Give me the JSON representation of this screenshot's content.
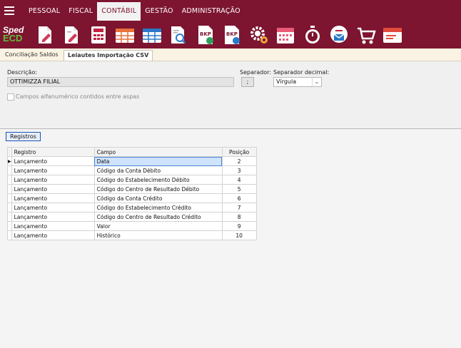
{
  "menu": [
    "PESSOAL",
    "FISCAL",
    "CONTÁBIL",
    "GESTÃO",
    "ADMINISTRAÇÃO"
  ],
  "active_menu": "CONTÁBIL",
  "logo": {
    "line1": "Sped",
    "line2": "ECD"
  },
  "toolbar_icons": [
    "document-edit-icon",
    "document-edit-icon",
    "calculator-icon",
    "table-orange-icon",
    "table-blue-icon",
    "document-search-icon",
    "bkp-backup-icon",
    "bkp-restore-icon",
    "settings-gears-icon",
    "calendar-icon",
    "stopwatch-icon",
    "mail-inbox-icon",
    "shopping-cart-icon",
    "message-card-icon"
  ],
  "toolbar_text": {
    "bkp": "BKP"
  },
  "tabs": [
    "Conciliação Saldos",
    "Leiautes Importação CSV"
  ],
  "form": {
    "descricao_label": "Descrição:",
    "descricao_value": "OTTIMIZZA FILIAL",
    "separador_label": "Separador:",
    "separador_value": ";",
    "separador_decimal_label": "Separador decimal:",
    "separador_decimal_value": "Vírgula",
    "checkbox_label": "Campos alfanumérico contidos entre aspas"
  },
  "grid": {
    "button": "Registros",
    "headers": [
      "Registro",
      "Campo",
      "Posição"
    ],
    "rows": [
      [
        "Lançamento",
        "Data",
        "2"
      ],
      [
        "Lançamento",
        "Código da Conta Débito",
        "3"
      ],
      [
        "Lançamento",
        "Código do Estabelecimento Débito",
        "4"
      ],
      [
        "Lançamento",
        "Código do Centro de Resultado Débito",
        "5"
      ],
      [
        "Lançamento",
        "Código da Conta Crédito",
        "6"
      ],
      [
        "Lançamento",
        "Código do Estabelecimento Crédito",
        "7"
      ],
      [
        "Lançamento",
        "Código do Centro de Resultado Crédito",
        "8"
      ],
      [
        "Lançamento",
        "Valor",
        "9"
      ],
      [
        "Lançamento",
        "Histórico",
        "10"
      ]
    ]
  },
  "colors": {
    "brand": "#7d1430",
    "accent_green": "#5fbf3a",
    "icon_red": "#c0233f",
    "selection": "#cfe3fb"
  }
}
